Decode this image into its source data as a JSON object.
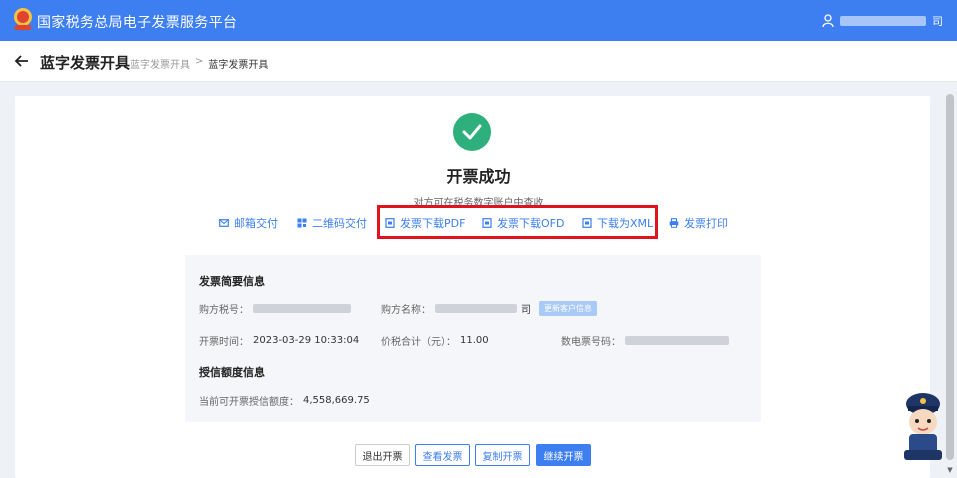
{
  "header": {
    "site_title": "国家税务总局电子发票服务平台",
    "user_tail": "司"
  },
  "subheader": {
    "page_title": "蓝字发票开具",
    "breadcrumb": [
      "蓝字发票开具",
      ">",
      "蓝字发票开具"
    ]
  },
  "result": {
    "title": "开票成功",
    "description": "对方可在税务数字账户中查收"
  },
  "actions": [
    {
      "label": "邮箱交付",
      "icon": "mail-icon"
    },
    {
      "label": "二维码交付",
      "icon": "qrcode-icon"
    },
    {
      "label": "发票下载PDF",
      "icon": "pdf-icon"
    },
    {
      "label": "发票下载OFD",
      "icon": "ofd-icon"
    },
    {
      "label": "下载为XML",
      "icon": "xml-icon"
    },
    {
      "label": "发票打印",
      "icon": "printer-icon"
    }
  ],
  "invoice_summary": {
    "title": "发票简要信息",
    "buyer_tax_no_label": "购方税号：",
    "buyer_name_label": "购方名称：",
    "buyer_name_tail": "司",
    "update_button": "更新客户信息",
    "issue_time_label": "开票时间：",
    "issue_time": "2023-03-29 10:33:04",
    "total_label": "价税合计（元）：",
    "total": "11.00",
    "invoice_no_label": "数电票号码："
  },
  "credit": {
    "title": "授信额度信息",
    "available_label": "当前可开票授信额度：",
    "available": "4,558,669.75"
  },
  "buttons": {
    "exit": "退出开票",
    "view": "查看发票",
    "copy": "复制开票",
    "continue": "继续开票"
  },
  "colors": {
    "brand": "#3d7ef0",
    "success": "#2db07c",
    "highlight": "#e0141e"
  }
}
